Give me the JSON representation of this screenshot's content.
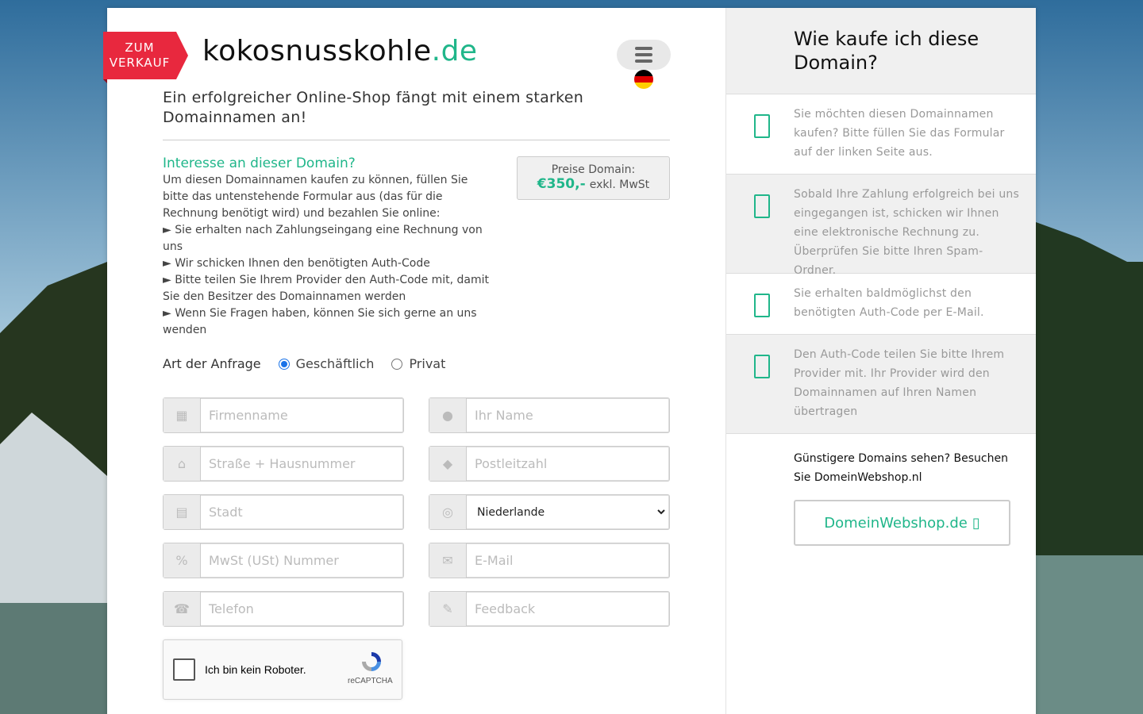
{
  "ribbon": {
    "line1": "ZUM",
    "line2": "VERKAUF"
  },
  "header": {
    "domain_name": "kokosnusskohle",
    "domain_tld": ".de",
    "menu_icon": "hamburger-icon",
    "language_flag": "german-flag"
  },
  "tagline": "Ein erfolgreicher Online-Shop fängt mit einem starken Domainnamen an!",
  "interest": {
    "heading": "Interesse an dieser Domain?",
    "intro": "Um diesen Domainnamen kaufen zu können, füllen Sie bitte das untenstehende Formular aus (das für die Rechnung benötigt wird) und bezahlen Sie online:",
    "bullets": [
      "► Sie erhalten nach Zahlungseingang eine Rechnung von uns",
      "► Wir schicken Ihnen den benötigten Auth-Code",
      "► Bitte teilen Sie Ihrem Provider den Auth-Code mit, damit Sie den Besitzer des Domainnamen werden",
      "► Wenn Sie Fragen haben, können Sie sich gerne an uns wenden"
    ]
  },
  "price": {
    "label": "Preise Domain:",
    "value": "€350,-",
    "tax": "exkl. MwSt"
  },
  "request_type": {
    "label": "Art der Anfrage",
    "options": [
      "Geschäftlich",
      "Privat"
    ],
    "selected": "Geschäftlich"
  },
  "form": {
    "company": "Firmenname",
    "name": "Ihr Name",
    "street": "Straße + Hausnummer",
    "zip": "Postleitzahl",
    "city": "Stadt",
    "country": "Niederlande",
    "vat": "MwSt (USt) Nummer",
    "email": "E-Mail",
    "phone": "Telefon",
    "feedback": "Feedback"
  },
  "captcha": {
    "label": "Ich bin kein Roboter.",
    "brand": "reCAPTCHA"
  },
  "sidebar": {
    "title": "Wie kaufe ich diese Domain?",
    "steps": [
      "Sie möchten diesen Domainnamen kaufen? Bitte füllen Sie das Formular auf der linken Seite aus.",
      "Sobald Ihre Zahlung erfolgreich bei uns eingegangen ist, schicken wir Ihnen eine elektronische Rechnung zu. Überprüfen Sie bitte Ihren Spam-Ordner.",
      "Sie erhalten baldmöglichst den benötigten Auth-Code per E-Mail.",
      "Den Auth-Code teilen Sie bitte Ihrem Provider mit. Ihr Provider wird den Domainnamen auf Ihren Namen übertragen"
    ],
    "cheaper_text": "Günstigere Domains sehen? Besuchen Sie DomeinWebshop.nl",
    "shop_button": "DomeinWebshop.de"
  },
  "colors": {
    "accent": "#20b68a",
    "ribbon": "#e8283e"
  }
}
